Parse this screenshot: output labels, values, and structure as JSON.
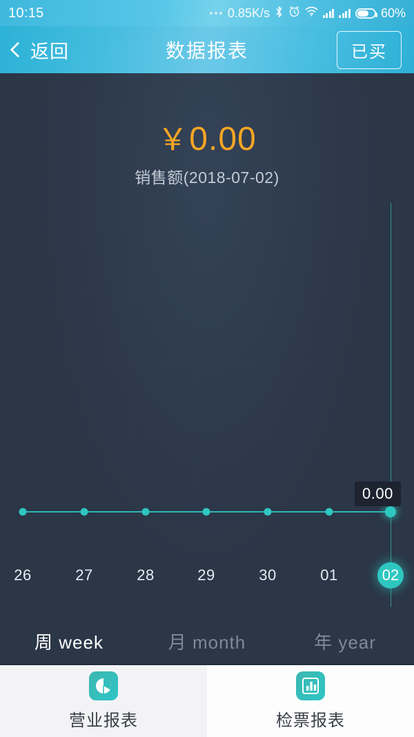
{
  "status_bar": {
    "time": "10:15",
    "network_speed": "0.85K/s",
    "battery_percent": "60%",
    "icons": [
      "more-dots-icon",
      "bluetooth-icon",
      "alarm-icon",
      "wifi-icon",
      "signal-icon",
      "signal-icon",
      "battery-icon"
    ]
  },
  "nav": {
    "back_label": "返回",
    "title": "数据报表",
    "action_label": "已买"
  },
  "summary": {
    "currency_symbol": "￥",
    "amount": "0.00",
    "caption": "销售额(2018-07-02)"
  },
  "chart_data": {
    "type": "line",
    "title": "销售额(2018-07-02)",
    "categories": [
      "26",
      "27",
      "28",
      "29",
      "30",
      "01",
      "02"
    ],
    "values": [
      0.0,
      0.0,
      0.0,
      0.0,
      0.0,
      0.0,
      0.0
    ],
    "series": [
      {
        "name": "销售额",
        "values": [
          0.0,
          0.0,
          0.0,
          0.0,
          0.0,
          0.0,
          0.0
        ]
      }
    ],
    "selected_index": 6,
    "selected_label": "02",
    "tooltip_value": "0.00",
    "xlabel": "",
    "ylabel": "",
    "ylim": [
      0,
      1
    ],
    "grid": false,
    "legend": "none",
    "line_color": "#2ec7c0",
    "point_color": "#2ec7c0"
  },
  "ranges": {
    "items": [
      {
        "label": "周 week",
        "active": true
      },
      {
        "label": "月 month",
        "active": false
      },
      {
        "label": "年 year",
        "active": false
      }
    ]
  },
  "tabbar": {
    "items": [
      {
        "label": "营业报表",
        "icon": "pie-chart-icon",
        "active": true
      },
      {
        "label": "检票报表",
        "icon": "bar-chart-icon",
        "active": false
      }
    ]
  },
  "colors": {
    "accent_teal": "#2ec7c0",
    "amount_orange": "#f5a623",
    "header_blue": "#4dbfe2",
    "panel_bg": "#2b3647"
  }
}
